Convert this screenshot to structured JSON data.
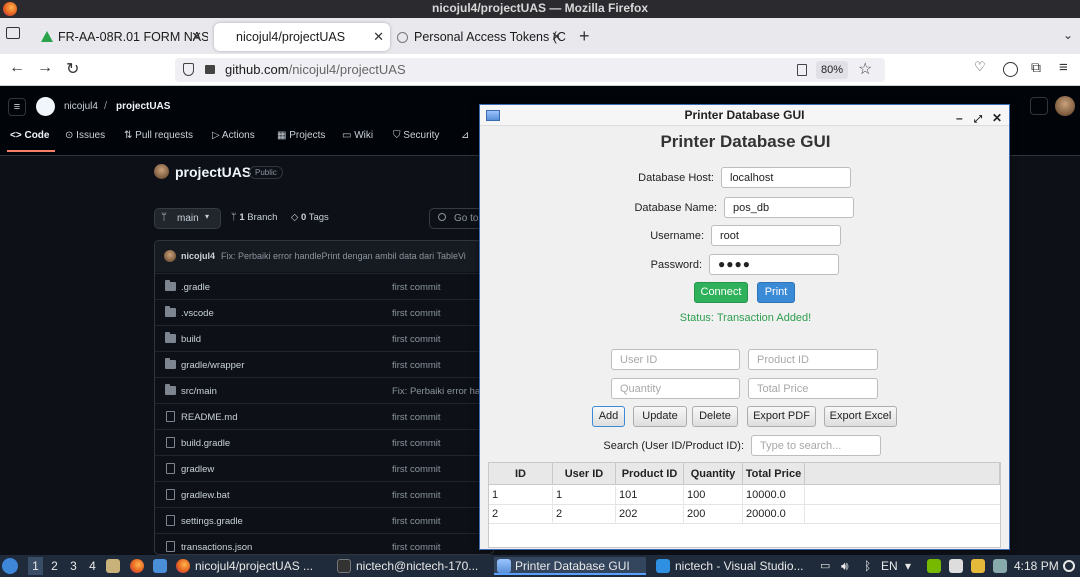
{
  "window": {
    "title": "nicojul4/projectUAS — Mozilla Firefox"
  },
  "tabs": [
    {
      "label": "FR-AA-08R.01 FORM NAS"
    },
    {
      "label": "nicojul4/projectUAS"
    },
    {
      "label": "Personal Access Tokens (C"
    }
  ],
  "nav": {
    "url_host": "github.com",
    "url_path": "/nicojul4/projectUAS",
    "zoom": "80%"
  },
  "github": {
    "owner": "nicojul4",
    "repo": "projectUAS",
    "tabs": [
      "Code",
      "Issues",
      "Pull requests",
      "Actions",
      "Projects",
      "Wiki",
      "Security"
    ],
    "repo_title": "projectUAS",
    "visibility": "Public",
    "branch": "main",
    "branch_count": "1",
    "branch_label": "Branch",
    "tag_count": "0",
    "tag_label": "Tags",
    "goto": "Go to",
    "commit_author": "nicojul4",
    "commit_message": "Fix: Perbaiki error handlePrint dengan ambil data dari TableVi",
    "files": [
      {
        "name": ".gradle",
        "type": "folder",
        "message": "first commit"
      },
      {
        "name": ".vscode",
        "type": "folder",
        "message": "first commit"
      },
      {
        "name": "build",
        "type": "folder",
        "message": "first commit"
      },
      {
        "name": "gradle/wrapper",
        "type": "folder",
        "message": "first commit"
      },
      {
        "name": "src/main",
        "type": "folder",
        "message": "Fix: Perbaiki error ha"
      },
      {
        "name": "README.md",
        "type": "file",
        "message": "first commit"
      },
      {
        "name": "build.gradle",
        "type": "file",
        "message": "first commit"
      },
      {
        "name": "gradlew",
        "type": "file",
        "message": "first commit"
      },
      {
        "name": "gradlew.bat",
        "type": "file",
        "message": "first commit"
      },
      {
        "name": "settings.gradle",
        "type": "file",
        "message": "first commit"
      },
      {
        "name": "transactions.json",
        "type": "file",
        "message": "first commit"
      }
    ]
  },
  "app": {
    "title": "Printer Database GUI",
    "heading": "Printer Database GUI",
    "host_label": "Database Host:",
    "host_value": "localhost",
    "dbname_label": "Database Name:",
    "dbname_value": "pos_db",
    "user_label": "Username:",
    "user_value": "root",
    "pass_label": "Password:",
    "pass_value": "●●●●",
    "connect_label": "Connect",
    "print_label": "Print",
    "status": "Status: Transaction Added!",
    "userid_ph": "User ID",
    "productid_ph": "Product ID",
    "quantity_ph": "Quantity",
    "totalprice_ph": "Total Price",
    "add_label": "Add",
    "update_label": "Update",
    "delete_label": "Delete",
    "exportpdf_label": "Export PDF",
    "exportexcel_label": "Export Excel",
    "search_label": "Search (User ID/Product ID):",
    "search_ph": "Type to search...",
    "columns": [
      "ID",
      "User ID",
      "Product ID",
      "Quantity",
      "Total Price"
    ],
    "rows": [
      [
        "1",
        "1",
        "101",
        "100",
        "10000.0"
      ],
      [
        "2",
        "2",
        "202",
        "200",
        "20000.0"
      ]
    ]
  },
  "taskbar": {
    "workspaces": [
      "1",
      "2",
      "3",
      "4"
    ],
    "items": [
      "nicojul4/projectUAS ...",
      "nictech@nictech-170...",
      "Printer Database GUI",
      "nictech - Visual Studio..."
    ],
    "lang": "EN",
    "clock": "4:18 PM"
  }
}
